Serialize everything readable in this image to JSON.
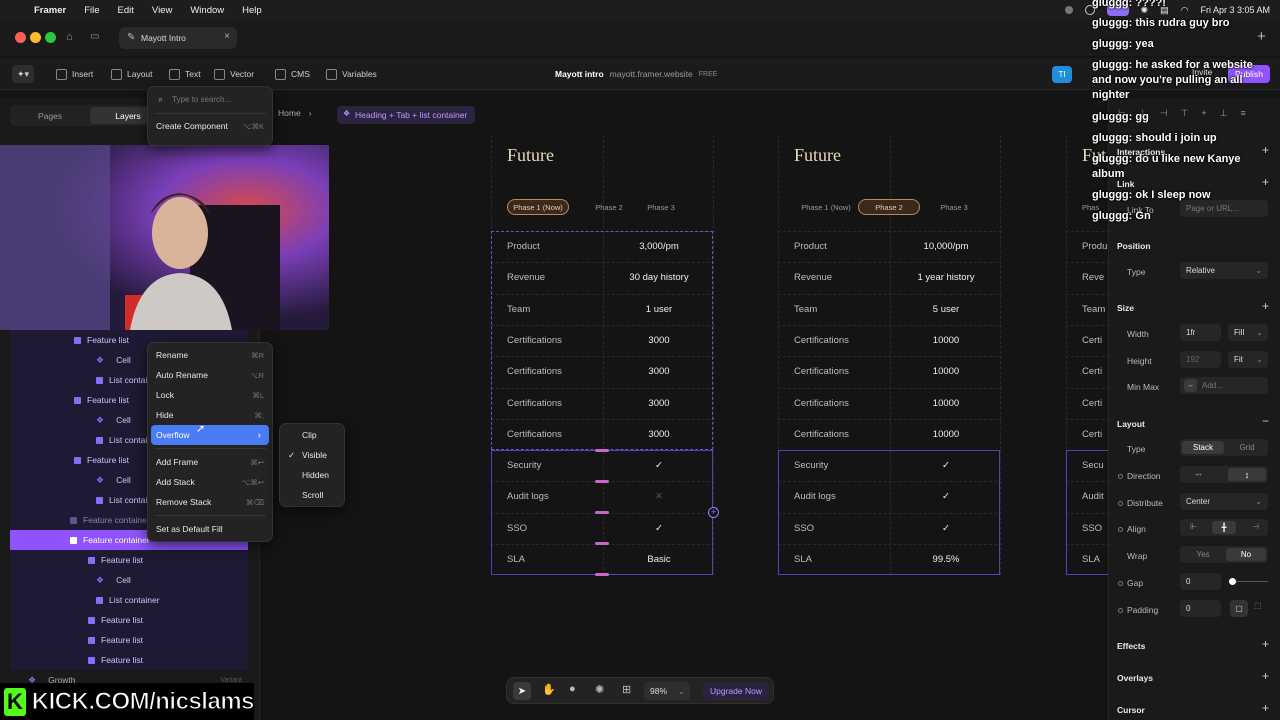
{
  "menubar": {
    "app": "Framer",
    "items": [
      "File",
      "Edit",
      "View",
      "Window",
      "Help"
    ],
    "datetime": "Fri Apr 3  3:05 AM"
  },
  "tab": {
    "title": "Mayott Intro"
  },
  "toolbar": {
    "insert": "Insert",
    "layout": "Layout",
    "text": "Text",
    "vector": "Vector",
    "cms": "CMS",
    "variables": "Variables",
    "project": "Mayott intro",
    "domain": "mayott.framer.website",
    "plan": "FREE",
    "avatar": "TI",
    "invite": "Invite",
    "publish": "Publish"
  },
  "leftpanel": {
    "tabs": [
      "Pages",
      "Layers"
    ],
    "layers": [
      {
        "label": "Feature list",
        "type": "frame"
      },
      {
        "label": "Cell",
        "type": "component"
      },
      {
        "label": "List container",
        "type": "stack"
      },
      {
        "label": "Feature list",
        "type": "frame"
      },
      {
        "label": "Cell",
        "type": "component"
      },
      {
        "label": "List container",
        "type": "stack"
      },
      {
        "label": "Feature list",
        "type": "frame"
      },
      {
        "label": "Cell",
        "type": "component"
      },
      {
        "label": "List container",
        "type": "stack"
      },
      {
        "label": "Feature container",
        "type": "frame"
      },
      {
        "label": "Feature container",
        "type": "frame"
      },
      {
        "label": "Feature list",
        "type": "frame"
      },
      {
        "label": "Cell",
        "type": "component"
      },
      {
        "label": "List container",
        "type": "stack"
      },
      {
        "label": "Feature list",
        "type": "frame"
      },
      {
        "label": "Feature list",
        "type": "frame"
      },
      {
        "label": "Feature list",
        "type": "frame"
      },
      {
        "label": "Growth",
        "type": "component"
      }
    ],
    "variant": "Variant"
  },
  "search_menu": {
    "placeholder": "Type to search...",
    "create_component": "Create Component",
    "create_component_sc": "⌥⌘K"
  },
  "context_menu": {
    "items": [
      {
        "label": "Rename",
        "sc": "⌘R"
      },
      {
        "label": "Auto Rename",
        "sc": "⌥R"
      },
      {
        "label": "Lock",
        "sc": "⌘L"
      },
      {
        "label": "Hide",
        "sc": "⌘;"
      },
      {
        "label": "Overflow",
        "sc": "›"
      },
      {
        "label": "Add Frame",
        "sc": "⌘↩"
      },
      {
        "label": "Add Stack",
        "sc": "⌥⌘↩"
      },
      {
        "label": "Remove Stack",
        "sc": "⌘⌫"
      },
      {
        "label": "Set as Default Fill",
        "sc": ""
      }
    ]
  },
  "overflow_submenu": {
    "items": [
      "Clip",
      "Visible",
      "Hidden",
      "Scroll"
    ],
    "checked": "Visible"
  },
  "breadcrumb": {
    "home": "Home",
    "current": "Heading + Tab + list container"
  },
  "cards": [
    {
      "title": "Future",
      "phases": [
        "Phase 1 (Now)",
        "Phase 2",
        "Phase 3"
      ],
      "active_phase": 0,
      "rows": [
        {
          "k": "Product",
          "v": "3,000/pm"
        },
        {
          "k": "Revenue",
          "v": "30 day history"
        },
        {
          "k": "Team",
          "v": "1 user"
        },
        {
          "k": "Certifications",
          "v": "3000"
        },
        {
          "k": "Certifications",
          "v": "3000"
        },
        {
          "k": "Certifications",
          "v": "3000"
        },
        {
          "k": "Certifications",
          "v": "3000"
        },
        {
          "k": "Security",
          "v": "✓"
        },
        {
          "k": "Audit logs",
          "v": "✕"
        },
        {
          "k": "SSO",
          "v": "✓"
        },
        {
          "k": "SLA",
          "v": "Basic"
        }
      ]
    },
    {
      "title": "Future",
      "phases": [
        "Phase 1 (Now)",
        "Phase 2",
        "Phase 3"
      ],
      "active_phase": 1,
      "rows": [
        {
          "k": "Product",
          "v": "10,000/pm"
        },
        {
          "k": "Revenue",
          "v": "1 year history"
        },
        {
          "k": "Team",
          "v": "5 user"
        },
        {
          "k": "Certifications",
          "v": "10000"
        },
        {
          "k": "Certifications",
          "v": "10000"
        },
        {
          "k": "Certifications",
          "v": "10000"
        },
        {
          "k": "Certifications",
          "v": "10000"
        },
        {
          "k": "Security",
          "v": "✓"
        },
        {
          "k": "Audit logs",
          "v": "✓"
        },
        {
          "k": "SSO",
          "v": "✓"
        },
        {
          "k": "SLA",
          "v": "99.5%"
        }
      ]
    },
    {
      "title": "Fut",
      "phases": [
        "Phas"
      ],
      "active_phase": -1,
      "rows": [
        {
          "k": "Produ",
          "v": ""
        },
        {
          "k": "Reve",
          "v": ""
        },
        {
          "k": "Team",
          "v": ""
        },
        {
          "k": "Certi",
          "v": ""
        },
        {
          "k": "Certi",
          "v": ""
        },
        {
          "k": "Certi",
          "v": ""
        },
        {
          "k": "Certi",
          "v": ""
        },
        {
          "k": "Secu",
          "v": ""
        },
        {
          "k": "Audit",
          "v": ""
        },
        {
          "k": "SSO",
          "v": ""
        },
        {
          "k": "SLA",
          "v": ""
        }
      ]
    }
  ],
  "rightpanel": {
    "interactions": "Interactions",
    "link": "Link",
    "link_to": "Link To",
    "link_placeholder": "Page or URL...",
    "position": "Position",
    "type_label": "Type",
    "position_type": "Relative",
    "size": "Size",
    "width_label": "Width",
    "width_value": "1fr",
    "width_mode": "Fill",
    "height_label": "Height",
    "height_value": "192",
    "height_mode": "Fit",
    "minmax_label": "Min Max",
    "minmax_add": "Add...",
    "layout": "Layout",
    "layout_type_label": "Type",
    "layout_stack": "Stack",
    "layout_grid": "Grid",
    "direction_label": "Direction",
    "distribute_label": "Distribute",
    "distribute_value": "Center",
    "align_label": "Align",
    "wrap_label": "Wrap",
    "wrap_yes": "Yes",
    "wrap_no": "No",
    "gap_label": "Gap",
    "gap_value": "0",
    "padding_label": "Padding",
    "padding_value": "0",
    "effects": "Effects",
    "overlays": "Overlays",
    "cursor": "Cursor"
  },
  "chat": [
    {
      "user": "gluggg:",
      "msg": "????!"
    },
    {
      "user": "gluggg:",
      "msg": "this rudra guy bro"
    },
    {
      "user": "gluggg:",
      "msg": "yea"
    },
    {
      "user": "gluggg:",
      "msg": "he asked for a website and now you're pulling an all nighter"
    },
    {
      "user": "gluggg:",
      "msg": "gg"
    },
    {
      "user": "gluggg:",
      "msg": "should i join up"
    },
    {
      "user": "gluggg:",
      "msg": "do u like new Kanye album"
    },
    {
      "user": "gluggg:",
      "msg": "ok I sleep now"
    },
    {
      "user": "gluggg:",
      "msg": "Gn"
    }
  ],
  "bottombar": {
    "zoom": "98%",
    "upgrade": "Upgrade Now"
  },
  "overlay": {
    "kick": "KICK.COM/nicslams"
  },
  "colors": {
    "accent": "#8f54ff",
    "card_border": "#5b3fb0",
    "phase_active": "#b98a55"
  }
}
